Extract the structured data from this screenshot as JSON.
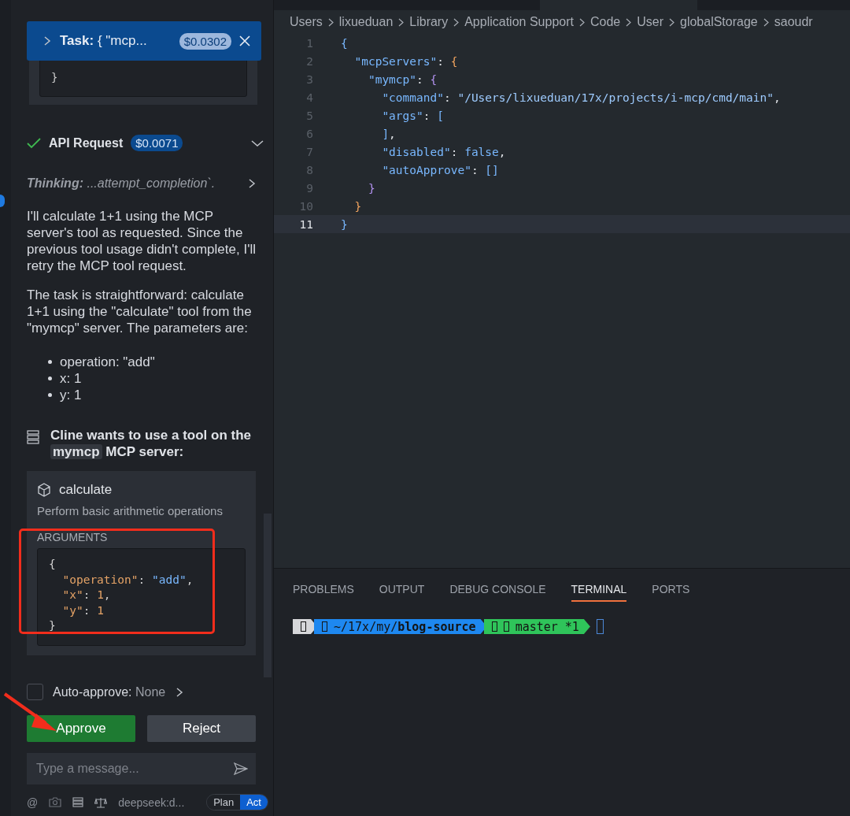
{
  "sidebar": {
    "task": {
      "label": "Task:",
      "text": "{ \"mcp...",
      "cost": "$0.0302"
    },
    "previous_code": [
      "}"
    ],
    "api_request": {
      "label": "API Request",
      "cost": "$0.0071"
    },
    "thinking": {
      "label": "Thinking:",
      "text": "...attempt_completion`."
    },
    "paragraphs": [
      "I'll calculate 1+1 using the MCP server's tool as requested. Since the previous tool usage didn't complete, I'll retry the MCP tool request.",
      "The task is straightforward: calculate 1+1 using the \"calculate\" tool from the \"mymcp\" server. The parameters are:"
    ],
    "bullets": [
      "operation: \"add\"",
      "x: 1",
      "y: 1"
    ],
    "tool_request": {
      "before": "Cline wants to use a tool on the",
      "server": "mymcp",
      "after": "MCP server:"
    },
    "tool": {
      "name": "calculate",
      "description": "Perform basic arithmetic operations",
      "arguments_label": "ARGUMENTS",
      "arguments": [
        [
          {
            "t": "{",
            "kind": "punct"
          }
        ],
        [
          {
            "t": "  \"operation\"",
            "kind": "key"
          },
          {
            "t": ": ",
            "kind": "punct"
          },
          {
            "t": "\"add\"",
            "kind": "string"
          },
          {
            "t": ",",
            "kind": "punct"
          }
        ],
        [
          {
            "t": "  \"x\"",
            "kind": "key"
          },
          {
            "t": ": ",
            "kind": "punct"
          },
          {
            "t": "1",
            "kind": "number"
          },
          {
            "t": ",",
            "kind": "punct"
          }
        ],
        [
          {
            "t": "  \"y\"",
            "kind": "key"
          },
          {
            "t": ": ",
            "kind": "punct"
          },
          {
            "t": "1",
            "kind": "number"
          }
        ],
        [
          {
            "t": "}",
            "kind": "punct"
          }
        ]
      ]
    },
    "auto_approve": {
      "label": "Auto-approve:",
      "value": "None",
      "checked": false
    },
    "buttons": [
      {
        "label": "Approve",
        "kind": "primary"
      },
      {
        "label": "Reject",
        "kind": "secondary"
      }
    ],
    "message_input": {
      "placeholder": "Type a message..."
    },
    "toolbar": {
      "mention": "@",
      "model": "deepseek:d...",
      "modes": [
        {
          "label": "Plan",
          "selected": false
        },
        {
          "label": "Act",
          "selected": true
        }
      ]
    }
  },
  "editor": {
    "breadcrumb": [
      "Users",
      "lixueduan",
      "Library",
      "Application Support",
      "Code",
      "User",
      "globalStorage",
      "saoudr"
    ],
    "lines": [
      {
        "number": "1",
        "active": false,
        "tokens": [
          {
            "t": "{",
            "kind": "bracket1"
          }
        ]
      },
      {
        "number": "2",
        "active": false,
        "tokens": [
          {
            "t": "  \"mcpServers\"",
            "kind": "key"
          },
          {
            "t": ": ",
            "kind": "punct"
          },
          {
            "t": "{",
            "kind": "bracket2"
          }
        ]
      },
      {
        "number": "3",
        "active": false,
        "tokens": [
          {
            "t": "    \"mymcp\"",
            "kind": "key"
          },
          {
            "t": ": ",
            "kind": "punct"
          },
          {
            "t": "{",
            "kind": "bracket3"
          }
        ]
      },
      {
        "number": "4",
        "active": false,
        "tokens": [
          {
            "t": "      \"command\"",
            "kind": "key"
          },
          {
            "t": ": ",
            "kind": "punct"
          },
          {
            "t": "\"/Users/lixueduan/17x/projects/i-mcp/cmd/main\"",
            "kind": "string"
          },
          {
            "t": ",",
            "kind": "punct"
          }
        ]
      },
      {
        "number": "5",
        "active": false,
        "tokens": [
          {
            "t": "      \"args\"",
            "kind": "key"
          },
          {
            "t": ": ",
            "kind": "punct"
          },
          {
            "t": "[",
            "kind": "bracket1"
          }
        ]
      },
      {
        "number": "6",
        "active": false,
        "tokens": [
          {
            "t": "      ]",
            "kind": "bracket1"
          },
          {
            "t": ",",
            "kind": "punct"
          }
        ]
      },
      {
        "number": "7",
        "active": false,
        "tokens": [
          {
            "t": "      \"disabled\"",
            "kind": "key"
          },
          {
            "t": ": ",
            "kind": "punct"
          },
          {
            "t": "false",
            "kind": "literal"
          },
          {
            "t": ",",
            "kind": "punct"
          }
        ]
      },
      {
        "number": "8",
        "active": false,
        "tokens": [
          {
            "t": "      \"autoApprove\"",
            "kind": "key"
          },
          {
            "t": ": ",
            "kind": "punct"
          },
          {
            "t": "[]",
            "kind": "bracket1"
          }
        ]
      },
      {
        "number": "9",
        "active": false,
        "tokens": [
          {
            "t": "    }",
            "kind": "bracket3"
          }
        ]
      },
      {
        "number": "10",
        "active": false,
        "tokens": [
          {
            "t": "  }",
            "kind": "bracket2"
          }
        ]
      },
      {
        "number": "11",
        "active": true,
        "tokens": [
          {
            "t": "}",
            "kind": "bracket1"
          }
        ]
      }
    ]
  },
  "panel": {
    "tabs": [
      {
        "label": "PROBLEMS",
        "selected": false
      },
      {
        "label": "OUTPUT",
        "selected": false
      },
      {
        "label": "DEBUG CONSOLE",
        "selected": false
      },
      {
        "label": "TERMINAL",
        "selected": true
      },
      {
        "label": "PORTS",
        "selected": false
      }
    ],
    "prompt": [
      {
        "kind": "os"
      },
      {
        "kind": "path",
        "text": "~/17x/my/**blog-source**"
      },
      {
        "kind": "git",
        "text": "master *1"
      }
    ]
  }
}
